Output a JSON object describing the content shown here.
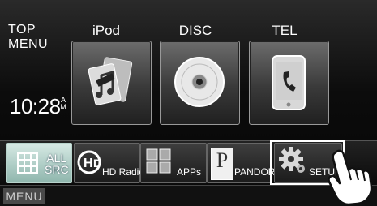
{
  "top_menu": {
    "line1": "TOP",
    "line2": "MENU"
  },
  "clock": {
    "time": "10:28",
    "ampm_top": "A",
    "ampm_bottom": "M"
  },
  "sources": [
    {
      "label": "iPod",
      "icon": "ipod-music-icon"
    },
    {
      "label": "DISC",
      "icon": "disc-icon"
    },
    {
      "label": "TEL",
      "icon": "phone-icon"
    }
  ],
  "shortcuts": {
    "all_src": {
      "line1": "ALL",
      "line2": "SRC",
      "icon": "grid-icon"
    },
    "hd_radio": {
      "label": "HD Radio",
      "icon": "hd-radio-icon"
    },
    "apps": {
      "label": "APPs",
      "icon": "apps-grid-icon"
    },
    "pandora": {
      "label": "PANDORA",
      "badge": "P",
      "icon": "pandora-icon"
    },
    "setup": {
      "label": "SETUP",
      "icon": "gear-icon"
    }
  },
  "menu": {
    "label": "MENU"
  },
  "colors": {
    "accent_all_src": "#a9cfc6",
    "background": "#111111"
  }
}
